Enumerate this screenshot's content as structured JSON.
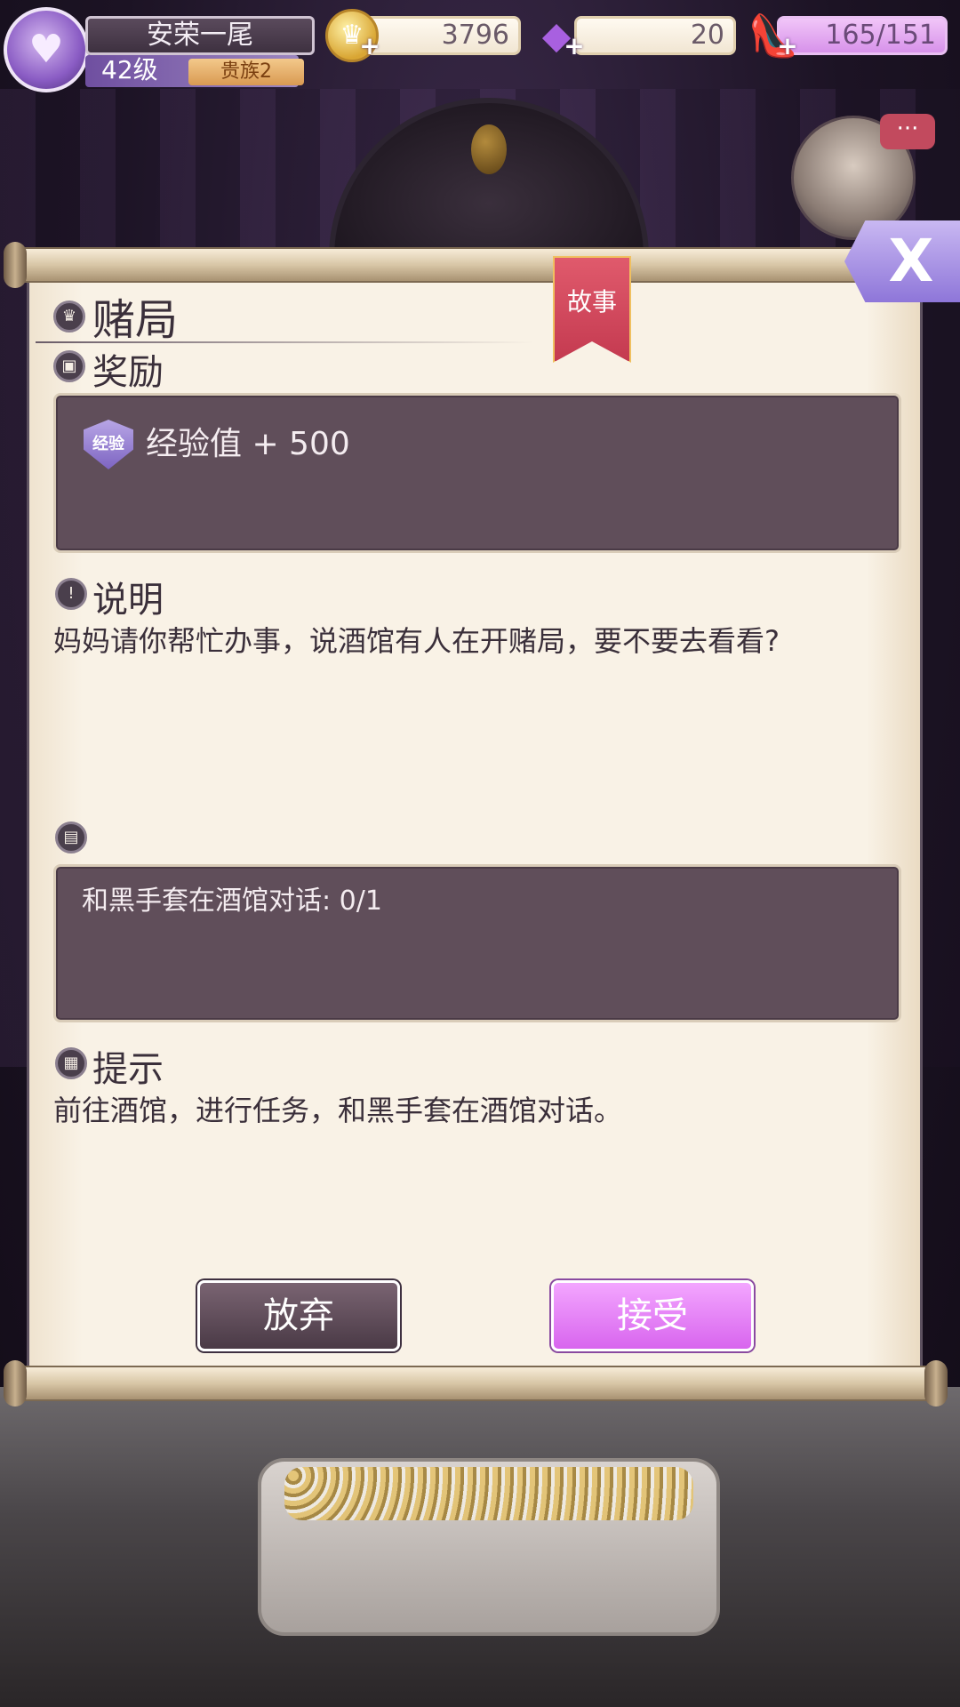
{
  "player": {
    "name": "安荣一尾",
    "level": "42级",
    "noble": "贵族2"
  },
  "resources": {
    "gold": "3796",
    "gems": "20",
    "stamina": "165/151"
  },
  "quest": {
    "title": "赌局",
    "ribbon": "故事",
    "reward_label": "奖励",
    "reward_badge": "经验",
    "reward_text": "经验值 + 500",
    "description_label": "说明",
    "description": "妈妈请你帮忙办事，说酒馆有人在开赌局，要不要去看看?",
    "objective": "和黑手套在酒馆对话: 0/1",
    "tip_label": "提示",
    "tip": "前往酒馆，进行任务，和黑手套在酒馆对话。"
  },
  "buttons": {
    "abandon": "放弃",
    "accept": "接受",
    "close": "X"
  },
  "icons": {
    "avatar": "heart-icon",
    "gold": "crown-coin-icon",
    "gem": "diamond-icon",
    "stamina": "glass-slipper-icon",
    "chat": "chat-bubble-icon",
    "title": "crown-icon",
    "reward": "box-icon",
    "description": "exclamation-icon",
    "objective": "book-icon",
    "tip": "note-icon"
  },
  "colors": {
    "accent": "#d865ee",
    "panel": "#f9f2e6",
    "box": "#604e5a",
    "ribbon": "#c43a50"
  }
}
